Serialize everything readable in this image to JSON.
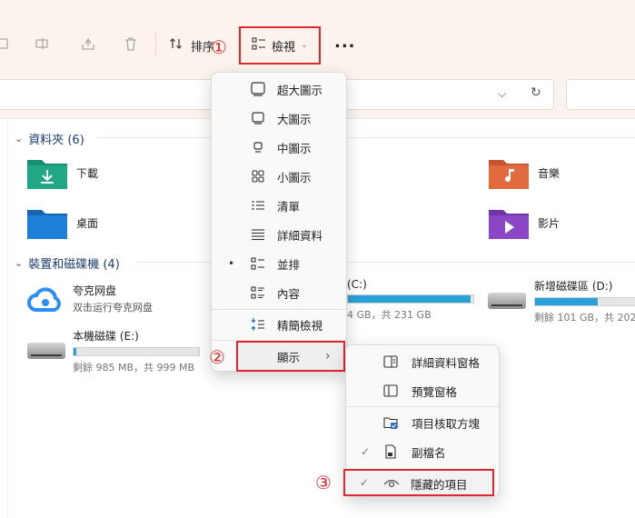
{
  "toolbar": {
    "sort_label": "排序",
    "view_label": "檢視",
    "more_label": "..."
  },
  "annotations": {
    "step1": "①",
    "step2": "②",
    "step3": "③"
  },
  "groups": {
    "folders_title": "資料夾 (6)",
    "drives_title": "裝置和磁碟機 (4)"
  },
  "folders": [
    {
      "name": "下載",
      "color": "#1fa883"
    },
    {
      "name": "桌面",
      "color": "#1e7fd6"
    },
    {
      "name": "音樂",
      "color": "#e16a3e"
    },
    {
      "name": "影片",
      "color": "#8a46c4"
    }
  ],
  "drives": [
    {
      "name": "夸克网盘",
      "info": "双击运行夸克网盘"
    },
    {
      "name": "(C:)",
      "info": "4 GB，共 231 GB",
      "fill": 0.98
    },
    {
      "name": "新增磁碟區 (D:)",
      "info": "剩餘 101 GB，共 202",
      "fill": 0.5
    },
    {
      "name": "本機磁碟 (E:)",
      "info": "剩餘 985 MB，共 999 MB",
      "fill": 0.02
    }
  ],
  "view_menu": {
    "items": [
      {
        "label": "超大圖示",
        "icon": "extra-large-icons-icon"
      },
      {
        "label": "大圖示",
        "icon": "large-icons-icon"
      },
      {
        "label": "中圖示",
        "icon": "medium-icons-icon"
      },
      {
        "label": "小圖示",
        "icon": "small-icons-icon"
      },
      {
        "label": "清單",
        "icon": "list-icon"
      },
      {
        "label": "詳細資料",
        "icon": "details-icon"
      },
      {
        "label": "並排",
        "icon": "tiles-icon",
        "bullet": "•"
      },
      {
        "label": "內容",
        "icon": "content-icon"
      }
    ],
    "compact_label": "精簡檢視",
    "show_label": "顯示",
    "show_arrow": "›"
  },
  "show_menu": {
    "details_pane": "詳細資料窗格",
    "preview_pane": "預覽窗格",
    "item_checkboxes": "項目核取方塊",
    "file_extensions": "副檔名",
    "hidden_items": "隱藏的項目",
    "check_mark": "✓"
  }
}
